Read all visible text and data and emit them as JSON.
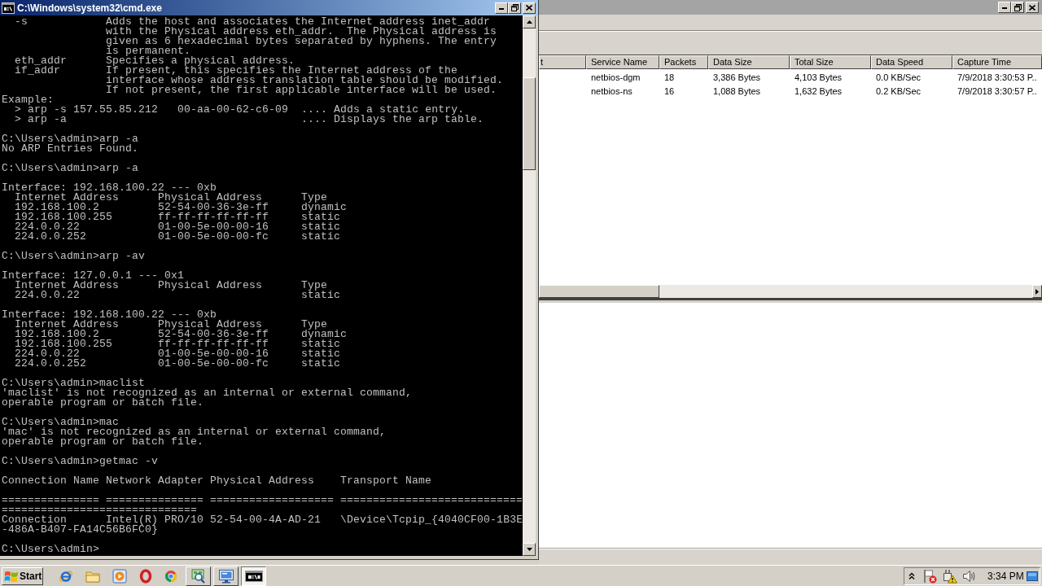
{
  "console_window": {
    "title": "C:\\Windows\\system32\\cmd.exe",
    "blocks": [
      [
        "  -s            Adds the host and associates the Internet address inet_addr",
        "                with the Physical address eth_addr.  The Physical address is",
        "                given as 6 hexadecimal bytes separated by hyphens. The entry",
        "                is permanent.",
        "  eth_addr      Specifies a physical address.",
        "  if_addr       If present, this specifies the Internet address of the",
        "                interface whose address translation table should be modified.",
        "                If not present, the first applicable interface will be used.",
        "Example:",
        "  > arp -s 157.55.85.212   00-aa-00-62-c6-09  .... Adds a static entry.",
        "  > arp -a                                    .... Displays the arp table."
      ],
      [
        "C:\\Users\\admin>arp -a",
        "No ARP Entries Found."
      ],
      [
        "C:\\Users\\admin>arp -a"
      ],
      [
        "Interface: 192.168.100.22 --- 0xb",
        "  Internet Address      Physical Address      Type",
        "  192.168.100.2         52-54-00-36-3e-ff     dynamic",
        "  192.168.100.255       ff-ff-ff-ff-ff-ff     static",
        "  224.0.0.22            01-00-5e-00-00-16     static",
        "  224.0.0.252           01-00-5e-00-00-fc     static"
      ],
      [
        "C:\\Users\\admin>arp -av"
      ],
      [
        "Interface: 127.0.0.1 --- 0x1",
        "  Internet Address      Physical Address      Type",
        "  224.0.0.22                                  static"
      ],
      [
        "Interface: 192.168.100.22 --- 0xb",
        "  Internet Address      Physical Address      Type",
        "  192.168.100.2         52-54-00-36-3e-ff     dynamic",
        "  192.168.100.255       ff-ff-ff-ff-ff-ff     static",
        "  224.0.0.22            01-00-5e-00-00-16     static",
        "  224.0.0.252           01-00-5e-00-00-fc     static"
      ],
      [
        "C:\\Users\\admin>maclist",
        "'maclist' is not recognized as an internal or external command,",
        "operable program or batch file."
      ],
      [
        "C:\\Users\\admin>mac",
        "'mac' is not recognized as an internal or external command,",
        "operable program or batch file."
      ],
      [
        "C:\\Users\\admin>getmac -v"
      ],
      [
        "Connection Name Network Adapter Physical Address    Transport Name"
      ],
      [
        "=============== =============== =================== ============================",
        "==============================",
        "Connection      Intel(R) PRO/10 52-54-00-4A-AD-21   \\Device\\Tcpip_{4040CF00-1B3E",
        "-486A-B407-FA14C56B6FC0}"
      ],
      [
        "C:\\Users\\admin>"
      ]
    ]
  },
  "capture_window": {
    "table": {
      "columns": [
        "t",
        "Service Name",
        "Packets",
        "Data Size",
        "Total Size",
        "Data Speed",
        "Capture Time"
      ],
      "rows": [
        [
          "",
          "netbios-dgm",
          "18",
          "3,386 Bytes",
          "4,103 Bytes",
          "0.0 KB/Sec",
          "7/9/2018 3:30:53 P.."
        ],
        [
          "",
          "netbios-ns",
          "16",
          "1,088 Bytes",
          "1,632 Bytes",
          "0.2 KB/Sec",
          "7/9/2018 3:30:57 P.."
        ]
      ]
    }
  },
  "taskbar": {
    "start": "Start",
    "task_buttons": [
      {
        "selected": false
      },
      {
        "selected": false
      },
      {
        "selected": true
      }
    ],
    "clock": "3:34 PM"
  }
}
